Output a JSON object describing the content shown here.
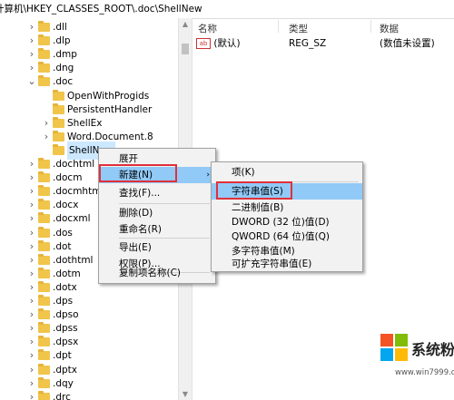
{
  "address": "计算机\\HKEY_CLASSES_ROOT\\.doc\\ShellNew",
  "tree": [
    {
      "label": ".dll",
      "expanded": false
    },
    {
      "label": ".dlp",
      "expanded": false
    },
    {
      "label": ".dmp",
      "expanded": false
    },
    {
      "label": ".dng",
      "expanded": false
    },
    {
      "label": ".doc",
      "expanded": true
    },
    {
      "label": "OpenWithProgids",
      "child": true
    },
    {
      "label": "PersistentHandler",
      "child": true
    },
    {
      "label": "ShellEx",
      "child": true,
      "expanded": false
    },
    {
      "label": "Word.Document.8",
      "child": true,
      "expanded": false
    },
    {
      "label": "ShellNew",
      "child": true,
      "selected": true
    },
    {
      "label": ".dochtml",
      "expanded": false
    },
    {
      "label": ".docm",
      "expanded": false
    },
    {
      "label": ".docmhtml",
      "expanded": false
    },
    {
      "label": ".docx",
      "expanded": false
    },
    {
      "label": ".docxml",
      "expanded": false
    },
    {
      "label": ".dos",
      "expanded": false
    },
    {
      "label": ".dot",
      "expanded": false
    },
    {
      "label": ".dothtml",
      "expanded": false
    },
    {
      "label": ".dotm",
      "expanded": false
    },
    {
      "label": ".dotx",
      "expanded": false
    },
    {
      "label": ".dps",
      "expanded": false
    },
    {
      "label": ".dpso",
      "expanded": false
    },
    {
      "label": ".dpss",
      "expanded": false
    },
    {
      "label": ".dpsx",
      "expanded": false
    },
    {
      "label": ".dpt",
      "expanded": false
    },
    {
      "label": ".dptx",
      "expanded": false
    },
    {
      "label": ".dqy",
      "expanded": false
    },
    {
      "label": ".drc",
      "expanded": false
    }
  ],
  "values": {
    "headers": {
      "name": "名称",
      "type": "类型",
      "data": "数据"
    },
    "rows": [
      {
        "icon": "ab",
        "name": "(默认)",
        "type": "REG_SZ",
        "data": "(数值未设置)"
      }
    ]
  },
  "context_menu": {
    "items": [
      {
        "label": "展开",
        "bold": false
      },
      {
        "label": "新建(N)",
        "submenu": true,
        "highlighted": true
      },
      {
        "label": "查找(F)..."
      },
      {
        "label": "删除(D)"
      },
      {
        "label": "重命名(R)"
      },
      {
        "label": "导出(E)"
      },
      {
        "label": "权限(P)..."
      },
      {
        "label": "复制项名称(C)"
      }
    ]
  },
  "submenu": {
    "items": [
      {
        "label": "项(K)"
      },
      {
        "label": "字符串值(S)",
        "highlighted": true
      },
      {
        "label": "二进制值(B)"
      },
      {
        "label": "DWORD (32 位)值(D)"
      },
      {
        "label": "QWORD (64 位)值(Q)"
      },
      {
        "label": "多字符串值(M)"
      },
      {
        "label": "可扩充字符串值(E)"
      }
    ]
  },
  "watermark": {
    "title": "系统粉",
    "url": "www.win7999.com"
  },
  "colors": {
    "highlight": "#91c9f7",
    "selection": "#cce8ff",
    "annotation": "#e0303a",
    "folder": "#f0c54a"
  }
}
